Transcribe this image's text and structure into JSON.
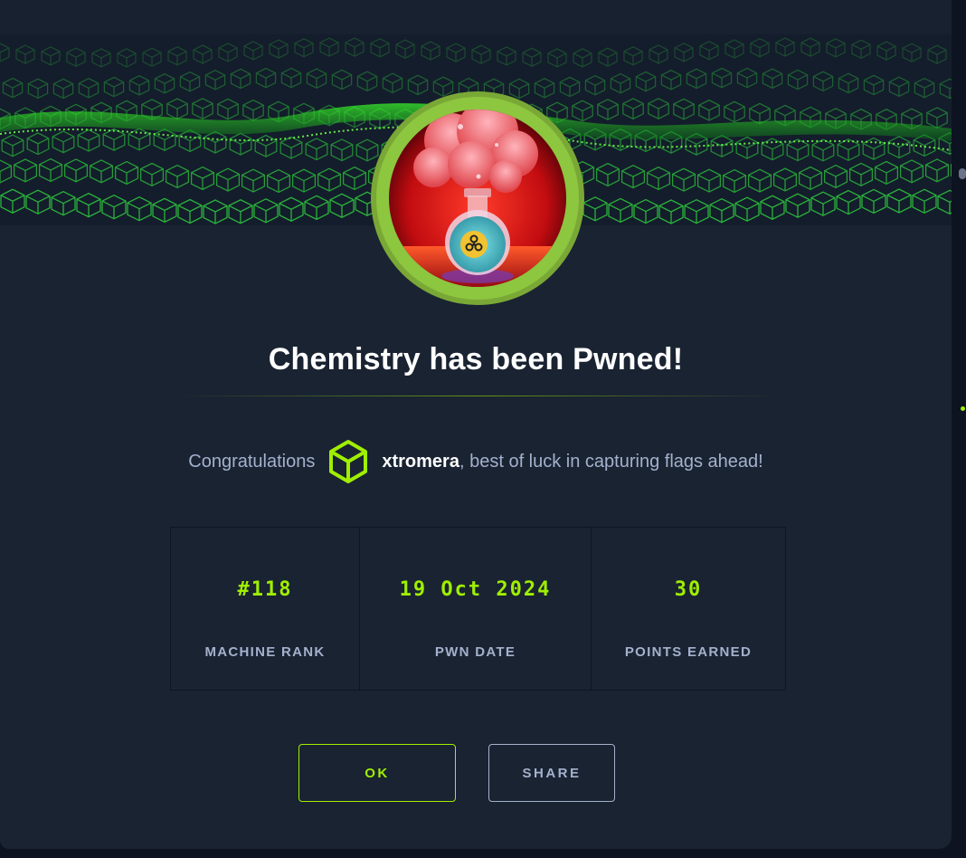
{
  "machine": {
    "title": "Chemistry has been Pwned!"
  },
  "congrats": {
    "prefix": "Congratulations",
    "username": "xtromera",
    "suffix": ", best of luck in capturing flags ahead!"
  },
  "stats": [
    {
      "value": "#118",
      "label": "MACHINE RANK"
    },
    {
      "value": "19 Oct 2024",
      "label": "PWN DATE"
    },
    {
      "value": "30",
      "label": "POINTS EARNED"
    }
  ],
  "buttons": {
    "ok": "OK",
    "share": "SHARE"
  },
  "colors": {
    "accent": "#9fef00",
    "background": "#1a2332",
    "muted_text": "#a4b1cd",
    "badge_ring": "#8dc63f"
  },
  "icons": {
    "user_badge": "hexagon-cube-icon",
    "machine_badge": "flask-biohazard-icon"
  }
}
